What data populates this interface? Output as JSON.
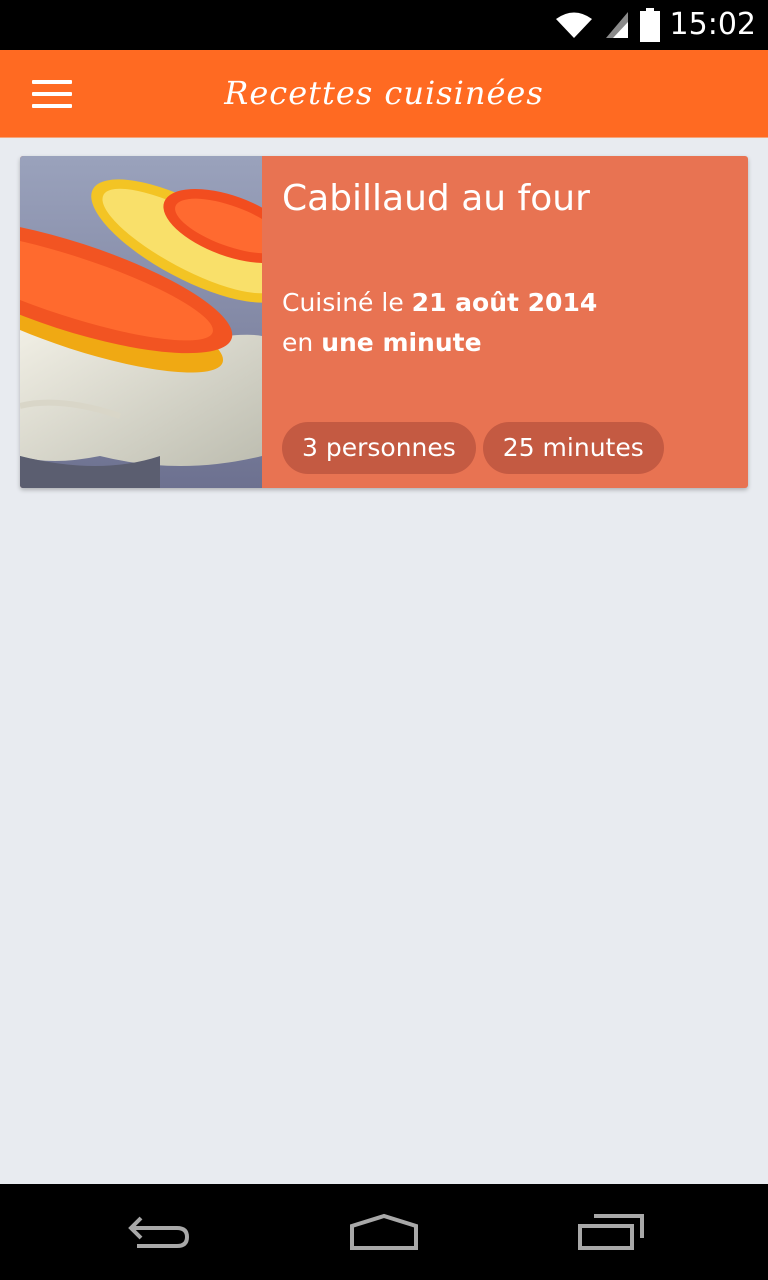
{
  "status": {
    "time": "15:02"
  },
  "app": {
    "title": "Recettes cuisinées"
  },
  "card": {
    "title": "Cabillaud au four",
    "cooked_prefix": "Cuisiné le ",
    "cooked_date": "21 août 2014",
    "duration_prefix": "en ",
    "duration": "une minute",
    "tags": [
      "3 personnes",
      "25 minutes"
    ]
  },
  "colors": {
    "app_bar": "#ff6a22",
    "card": "#e87352",
    "tag": "#c45a42",
    "background": "#e8ebf0"
  },
  "icons": {
    "menu": "hamburger-icon",
    "wifi": "wifi-icon",
    "signal": "signal-icon",
    "battery": "battery-icon",
    "back": "back-icon",
    "home": "home-icon",
    "recent": "recent-apps-icon"
  }
}
